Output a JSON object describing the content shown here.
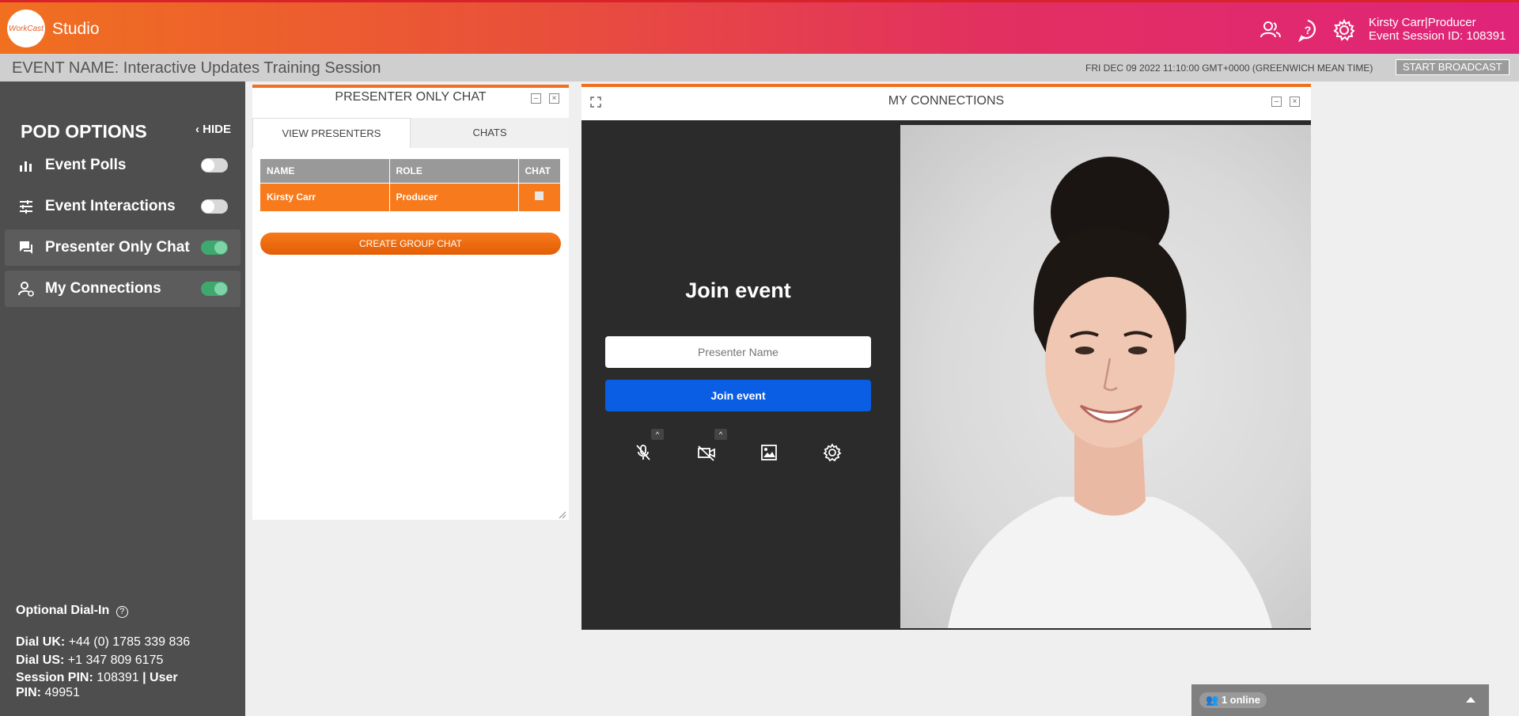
{
  "app": {
    "logo_text": "WorkCast",
    "title": "Studio",
    "user_line": "Kirsty Carr|Producer",
    "session_line": "Event Session ID: 108391"
  },
  "event": {
    "label": "EVENT NAME:",
    "name": "Interactive Updates Training Session",
    "datetime": "FRI DEC 09 2022 11:10:00 GMT+0000 (GREENWICH MEAN TIME)",
    "start_broadcast": "START BROADCAST"
  },
  "sidebar": {
    "title": "POD OPTIONS",
    "hide": "HIDE",
    "items": [
      {
        "label": "Event Polls",
        "icon": "bar-chart-icon",
        "on": false
      },
      {
        "label": "Event Interactions",
        "icon": "sliders-icon",
        "on": false
      },
      {
        "label": "Presenter Only Chat",
        "icon": "chat-icon",
        "on": true
      },
      {
        "label": "My Connections",
        "icon": "user-connection-icon",
        "on": true
      }
    ],
    "dial": {
      "title": "Optional Dial-In",
      "uk_label": "Dial UK:",
      "uk_value": "+44 (0) 1785 339 836",
      "us_label": "Dial US:",
      "us_value": "+1 347 809 6175",
      "pin_label": "Session PIN:",
      "pin_value": "108391",
      "sep": "|",
      "user_label": "User",
      "user_pin_label": "PIN:",
      "user_pin_value": "49951"
    }
  },
  "presenter_chat": {
    "title": "PRESENTER ONLY CHAT",
    "tabs": [
      "VIEW PRESENTERS",
      "CHATS"
    ],
    "columns": [
      "NAME",
      "ROLE",
      "CHAT"
    ],
    "rows": [
      {
        "name": "Kirsty Carr",
        "role": "Producer"
      }
    ],
    "create_group": "CREATE GROUP CHAT"
  },
  "connections": {
    "title": "MY CONNECTIONS",
    "join_title": "Join event",
    "name_placeholder": "Presenter Name",
    "join_button": "Join event"
  },
  "online": {
    "count_text": "1 online"
  },
  "colors": {
    "accent": "#f07020",
    "brand_pink": "#e0247a",
    "join_blue": "#0a5ee3",
    "toggle_on": "#3ea86f"
  }
}
